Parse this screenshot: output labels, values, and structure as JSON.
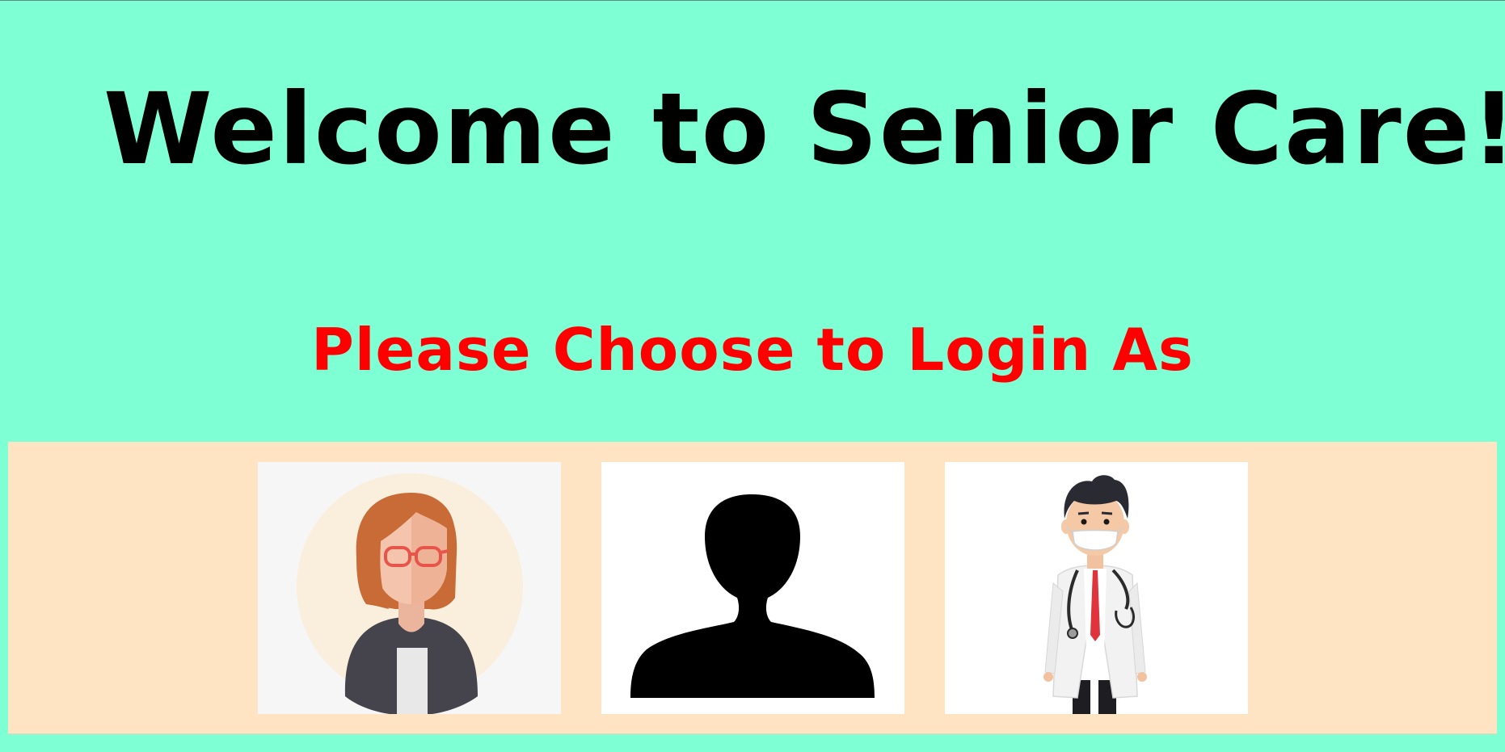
{
  "page": {
    "title": "Welcome to Senior Care!",
    "subtitle": "Please Choose to Login As"
  },
  "colors": {
    "background": "#7fffd4",
    "panel": "#ffe4c4",
    "title": "#000000",
    "subtitle": "#ff0000"
  },
  "roles": [
    {
      "icon": "female-user-avatar-icon"
    },
    {
      "icon": "person-silhouette-icon"
    },
    {
      "icon": "doctor-avatar-icon"
    }
  ]
}
